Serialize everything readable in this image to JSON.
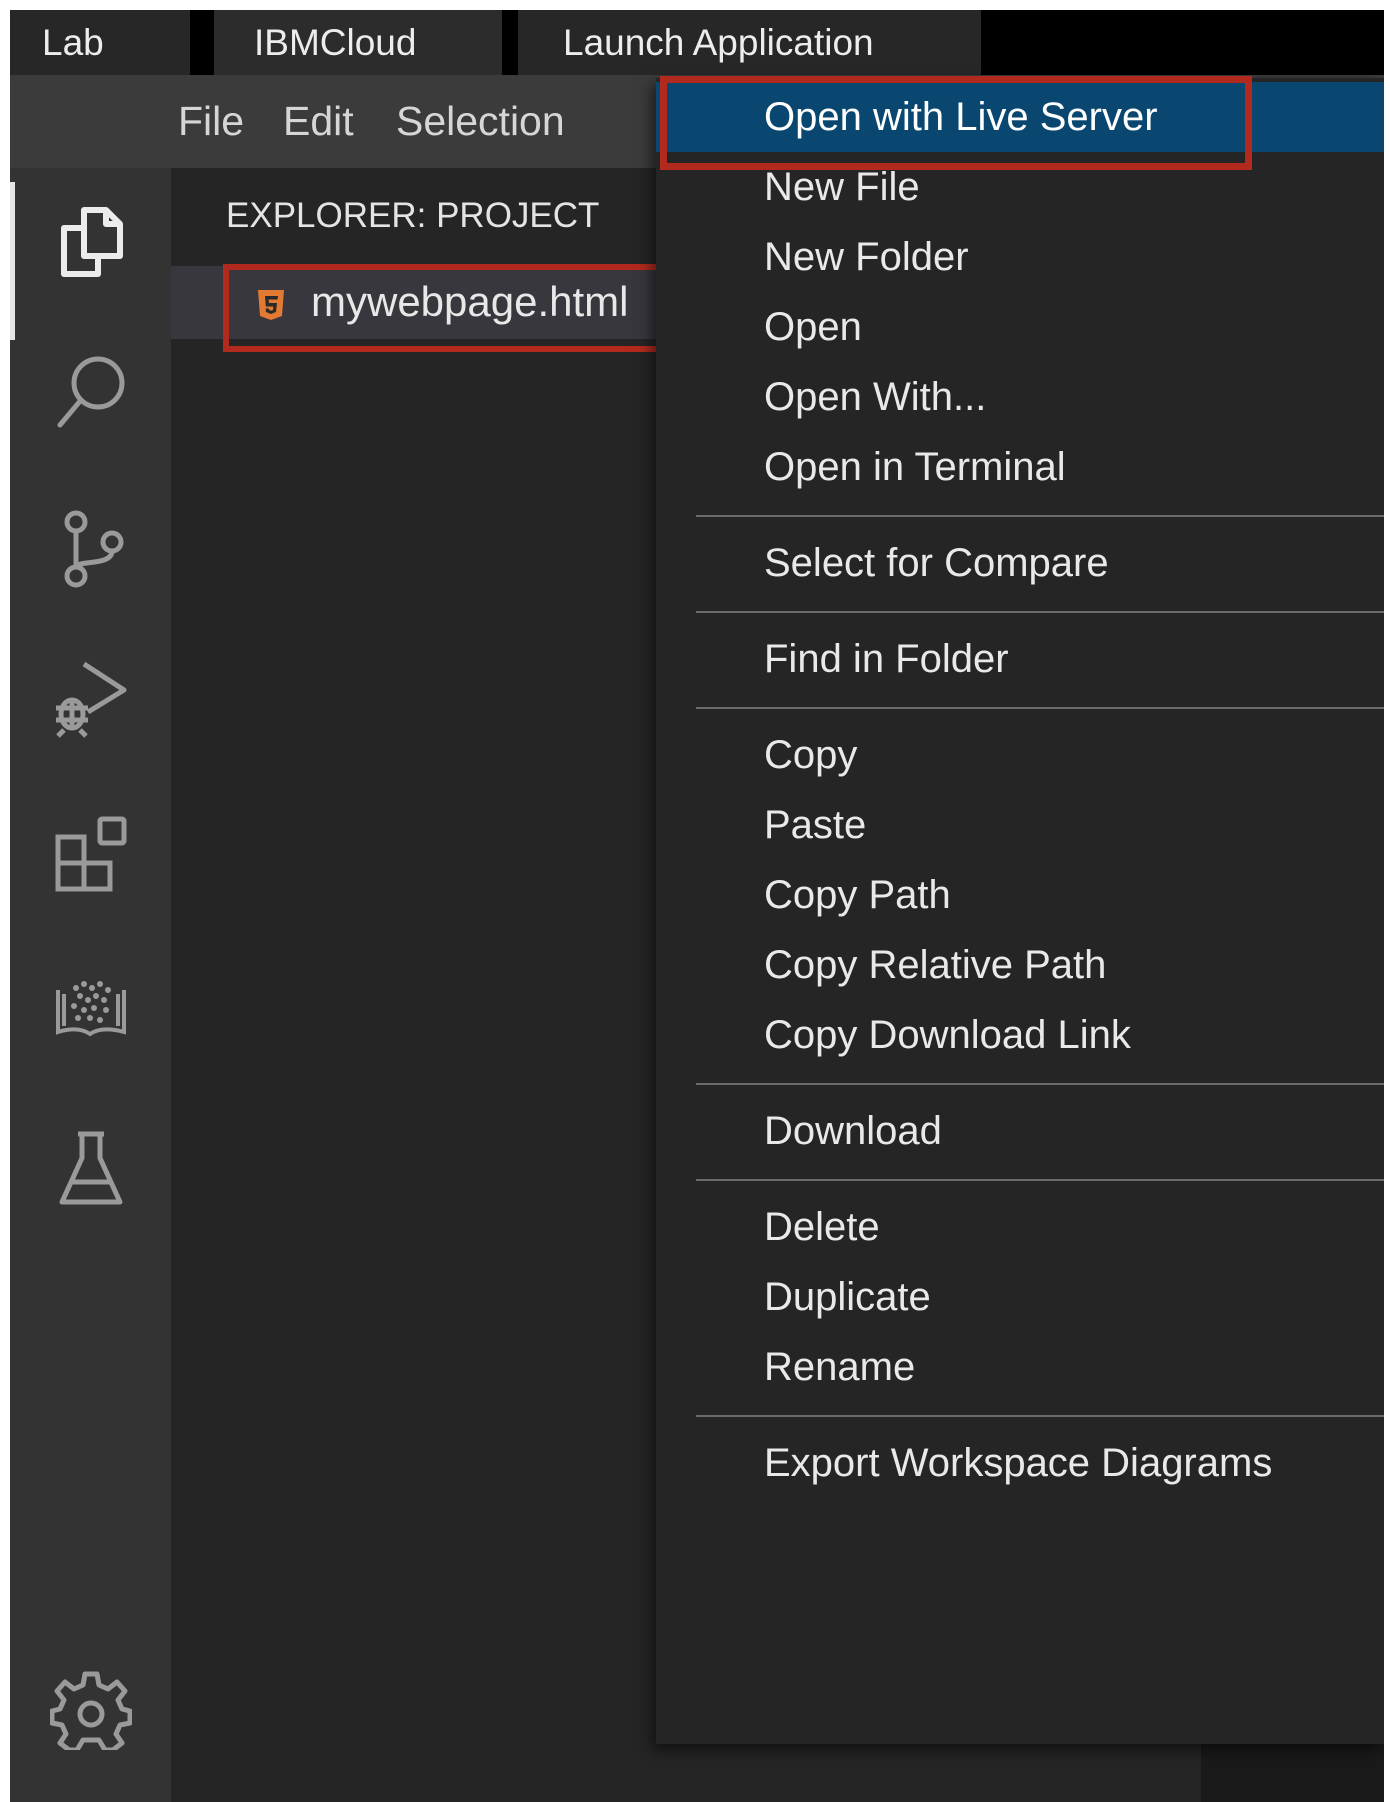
{
  "app_tabs": [
    "Lab",
    "IBMCloud",
    "Launch Application"
  ],
  "menu_bar": [
    "File",
    "Edit",
    "Selection"
  ],
  "activity_bar": {
    "icons": [
      "explorer-icon",
      "search-icon",
      "source-control-icon",
      "run-debug-icon",
      "extensions-icon",
      "skills-network-icon",
      "lab-flask-icon",
      "settings-gear-icon"
    ],
    "active": "explorer-icon"
  },
  "explorer": {
    "title": "EXPLORER: PROJECT",
    "file": {
      "name": "mywebpage.html",
      "icon": "html5-icon",
      "icon_color": "#e37933"
    }
  },
  "context_menu": {
    "groups": [
      [
        "Open with Live Server",
        "New File",
        "New Folder",
        "Open",
        "Open With...",
        "Open in Terminal"
      ],
      [
        "Select for Compare"
      ],
      [
        "Find in Folder"
      ],
      [
        "Copy",
        "Paste",
        "Copy Path",
        "Copy Relative Path",
        "Copy Download Link"
      ],
      [
        "Download"
      ],
      [
        "Delete",
        "Duplicate",
        "Rename"
      ],
      [
        "Export Workspace Diagrams"
      ]
    ],
    "selected": "Open with Live Server"
  },
  "colors": {
    "highlight_box": "#b22a1d",
    "selection": "#094771",
    "menu_bg": "#252526",
    "activity_bar": "#333333"
  }
}
